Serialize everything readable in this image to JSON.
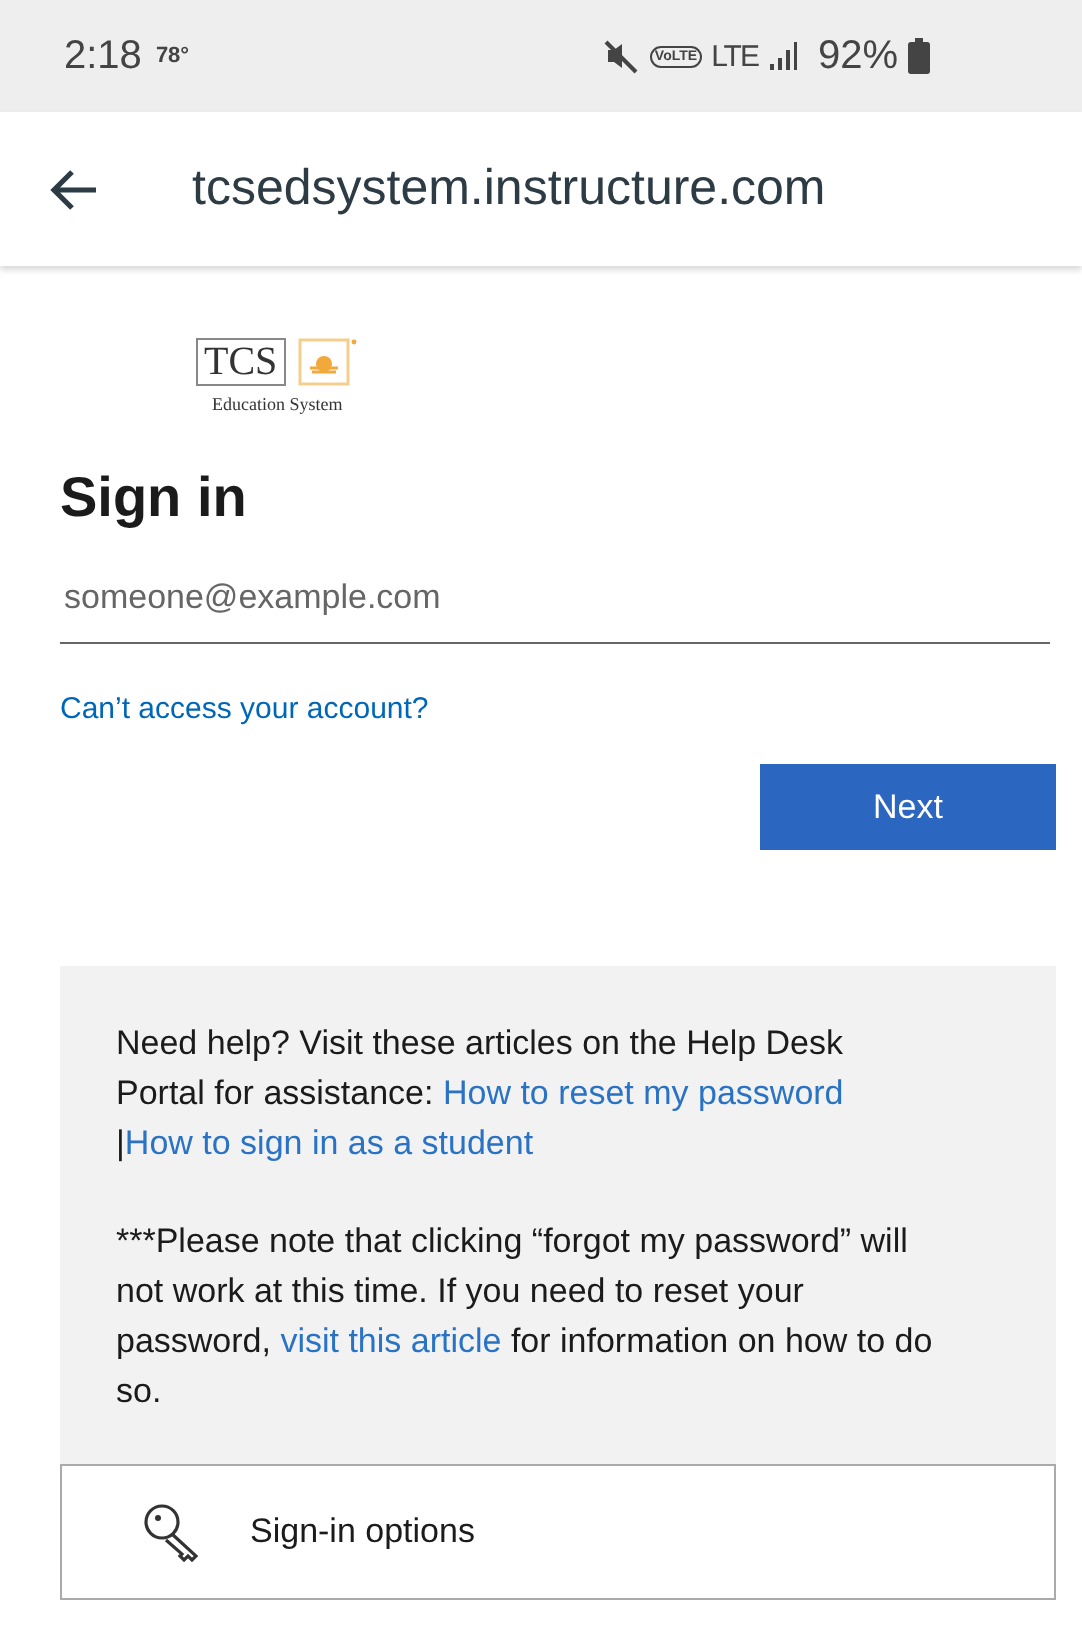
{
  "status_bar": {
    "time": "2:18",
    "temperature": "78°",
    "volte": "VoLTE",
    "network": "LTE",
    "battery": "92%"
  },
  "header": {
    "url": "tcsedsystem.instructure.com"
  },
  "logo": {
    "name": "TCS",
    "tagline": "Education System"
  },
  "title": "Sign in",
  "email_field": {
    "placeholder": "someone@example.com"
  },
  "account_link": "Can’t access your account?",
  "next_button": "Next",
  "help": {
    "paragraphs": [
      [
        {
          "text": "Need help? Visit these articles on the Help Desk Portal for assistance: ",
          "link": false
        },
        {
          "text": "How to reset my password",
          "link": true
        },
        {
          "text": " |",
          "link": false
        },
        {
          "text": "How to sign in as a student",
          "link": true
        }
      ],
      [
        {
          "text": "***Please note that clicking “forgot my password” will not work at this time. If you need to reset your password, ",
          "link": false
        },
        {
          "text": "visit this article",
          "link": true
        },
        {
          "text": " for information on how to do so.",
          "link": false
        }
      ]
    ]
  },
  "sign_in_options": "Sign-in options"
}
